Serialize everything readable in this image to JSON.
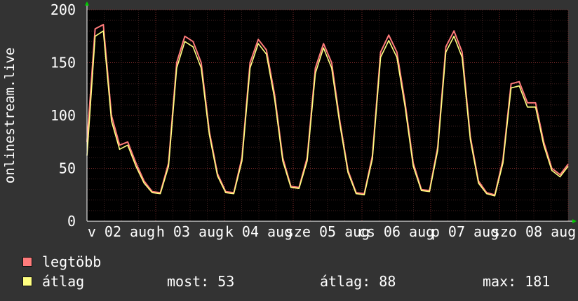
{
  "colors": {
    "background": "#333333",
    "plot_background": "#000000",
    "grid_minor": "#3a1e1e",
    "grid_major": "#7a2a2a",
    "series_max": "#ff7b7b",
    "series_avg": "#ffff80",
    "axis_arrow": "#00cc00"
  },
  "chart_data": {
    "type": "line",
    "ylabel": "onlinestream.live",
    "ylim": [
      0,
      200
    ],
    "yticks": [
      "0",
      "50",
      "100",
      "150",
      "200"
    ],
    "xticks": [
      "v 02 aug",
      "h 03 aug",
      "k 04 aug",
      "sze 05 aug",
      "cs 06 aug",
      "p 07 aug",
      "szo 08 aug"
    ],
    "grid": true,
    "series": [
      {
        "name": "legtöbb",
        "color": "#ff7b7b",
        "values": [
          75,
          182,
          186,
          100,
          72,
          75,
          55,
          38,
          28,
          27,
          55,
          150,
          175,
          170,
          150,
          85,
          45,
          28,
          27,
          60,
          150,
          172,
          162,
          120,
          60,
          33,
          32,
          60,
          145,
          168,
          150,
          95,
          48,
          27,
          26,
          62,
          160,
          176,
          160,
          112,
          55,
          30,
          29,
          70,
          165,
          180,
          160,
          80,
          38,
          27,
          25,
          58,
          130,
          132,
          112,
          112,
          75,
          50,
          44,
          54
        ]
      },
      {
        "name": "átlag",
        "color": "#ffff80",
        "values": [
          62,
          175,
          180,
          95,
          68,
          72,
          52,
          36,
          27,
          26,
          52,
          145,
          170,
          165,
          145,
          82,
          43,
          27,
          26,
          57,
          145,
          168,
          158,
          116,
          57,
          32,
          31,
          57,
          140,
          164,
          145,
          92,
          46,
          26,
          25,
          59,
          155,
          171,
          155,
          108,
          52,
          29,
          28,
          67,
          160,
          175,
          155,
          77,
          36,
          26,
          24,
          55,
          126,
          128,
          108,
          108,
          72,
          48,
          42,
          52
        ]
      }
    ]
  },
  "legend": {
    "max_label": "legtöbb",
    "avg_label": "átlag"
  },
  "stats": {
    "now": "most: 53",
    "avg": "átlag: 88",
    "max": "max: 181"
  }
}
